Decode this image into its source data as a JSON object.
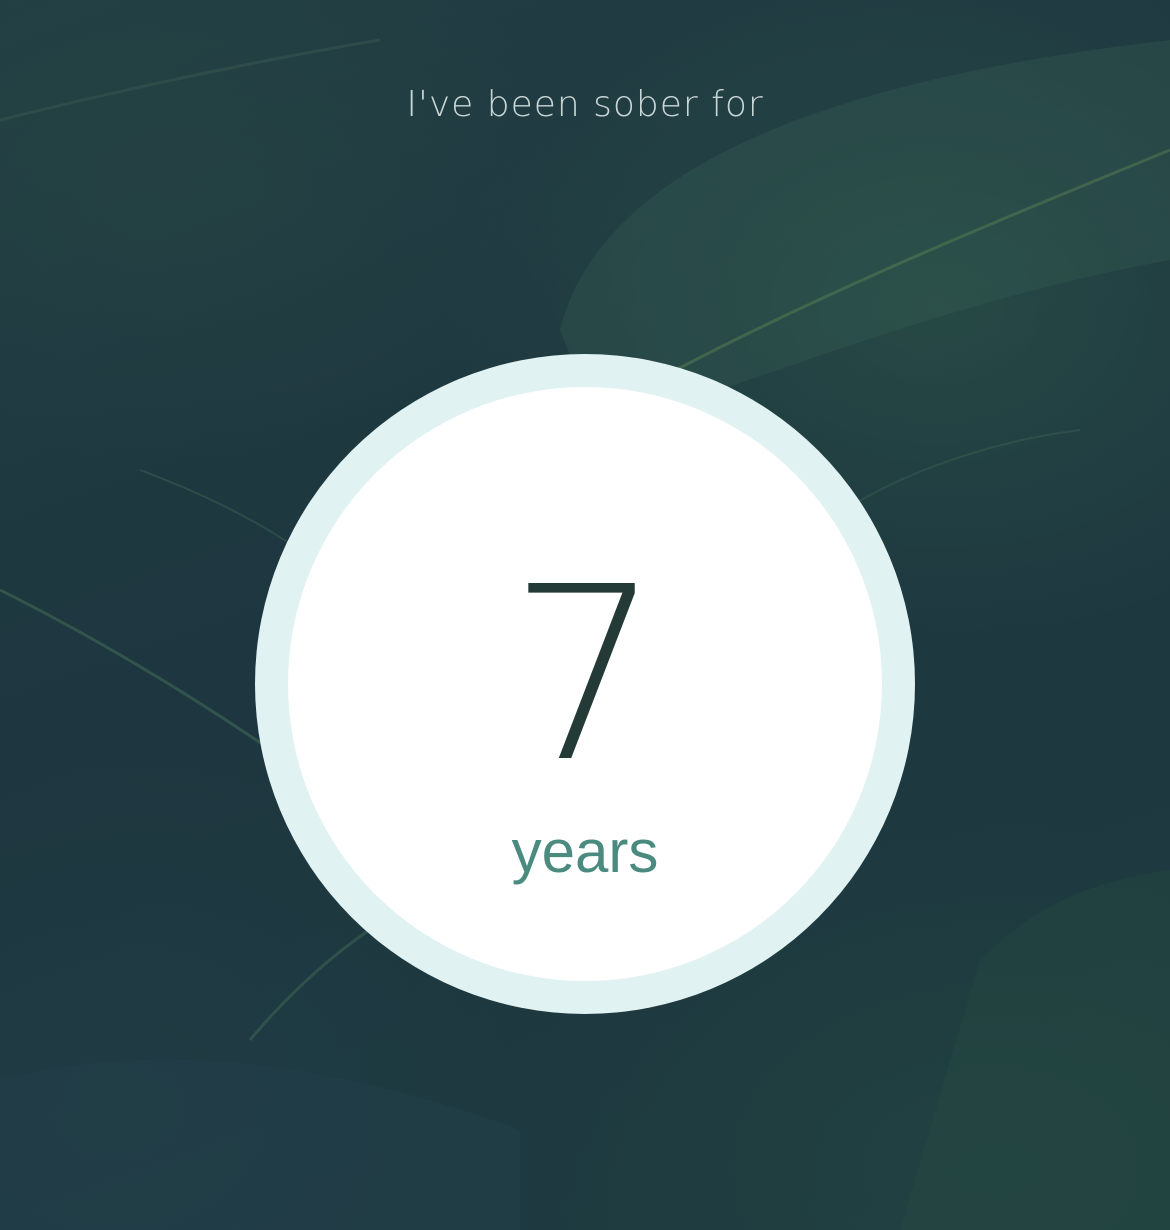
{
  "header": {
    "title": "I've been sober for"
  },
  "counter": {
    "value": "7",
    "unit": "years"
  },
  "colors": {
    "ring": "#e0f2f1",
    "disc": "#ffffff",
    "value_text": "#243a36",
    "unit_text": "#4a8a7f",
    "title_text": "#c9d6d6"
  }
}
